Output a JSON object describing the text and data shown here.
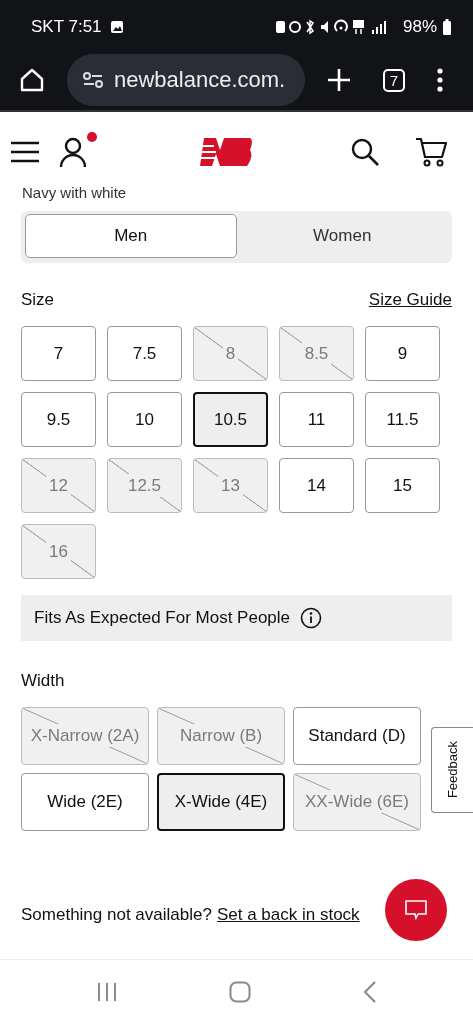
{
  "status_bar": {
    "carrier_time": "SKT 7:51",
    "battery": "98%"
  },
  "browser": {
    "url": "newbalance.com.",
    "tab_count": "7"
  },
  "header": {
    "notification": true
  },
  "product": {
    "color_name": "Navy with white"
  },
  "gender_tabs": [
    {
      "label": "Men",
      "selected": true
    },
    {
      "label": "Women",
      "selected": false
    }
  ],
  "size": {
    "label": "Size",
    "guide_link": "Size Guide",
    "options": [
      {
        "label": "7",
        "disabled": false,
        "selected": false
      },
      {
        "label": "7.5",
        "disabled": false,
        "selected": false
      },
      {
        "label": "8",
        "disabled": true,
        "selected": false
      },
      {
        "label": "8.5",
        "disabled": true,
        "selected": false
      },
      {
        "label": "9",
        "disabled": false,
        "selected": false
      },
      {
        "label": "9.5",
        "disabled": false,
        "selected": false
      },
      {
        "label": "10",
        "disabled": false,
        "selected": false
      },
      {
        "label": "10.5",
        "disabled": false,
        "selected": true
      },
      {
        "label": "11",
        "disabled": false,
        "selected": false
      },
      {
        "label": "11.5",
        "disabled": false,
        "selected": false
      },
      {
        "label": "12",
        "disabled": true,
        "selected": false
      },
      {
        "label": "12.5",
        "disabled": true,
        "selected": false
      },
      {
        "label": "13",
        "disabled": true,
        "selected": false
      },
      {
        "label": "14",
        "disabled": false,
        "selected": false
      },
      {
        "label": "15",
        "disabled": false,
        "selected": false
      },
      {
        "label": "16",
        "disabled": true,
        "selected": false
      }
    ]
  },
  "fit_banner": {
    "text": "Fits As Expected For Most People"
  },
  "width": {
    "label": "Width",
    "options": [
      {
        "label": "X-Narrow (2A)",
        "disabled": true,
        "selected": false
      },
      {
        "label": "Narrow (B)",
        "disabled": true,
        "selected": false
      },
      {
        "label": "Standard (D)",
        "disabled": false,
        "selected": false
      },
      {
        "label": "Wide (2E)",
        "disabled": false,
        "selected": false
      },
      {
        "label": "X-Wide (4E)",
        "disabled": false,
        "selected": true
      },
      {
        "label": "XX-Wide (6E)",
        "disabled": true,
        "selected": false
      }
    ]
  },
  "feedback_tab": "Feedback",
  "back_in_stock": {
    "text": "Something not available?",
    "link": "Set a back in stock"
  }
}
